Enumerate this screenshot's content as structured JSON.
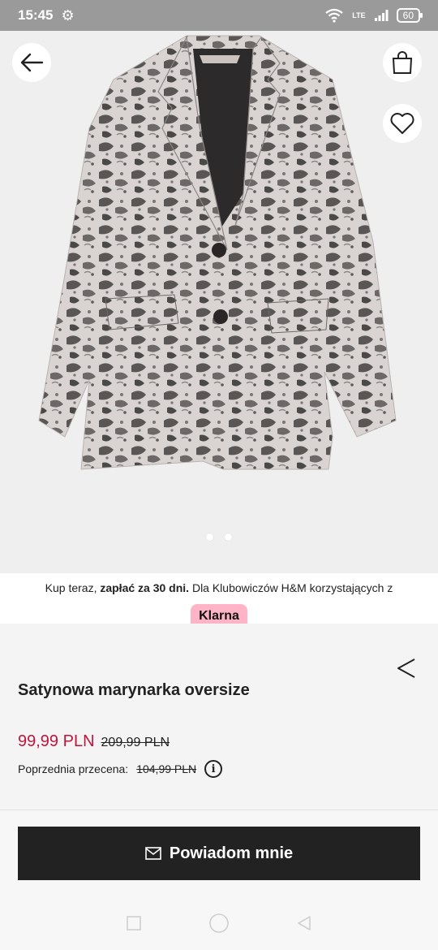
{
  "status_bar": {
    "time": "15:45",
    "network": "LTE",
    "battery": "60"
  },
  "hero": {
    "icons": {
      "back": "arrow-left-icon",
      "bag": "shopping-bag-icon",
      "favorite": "heart-icon"
    },
    "carousel_dots": 2
  },
  "promo": {
    "prefix": "Kup teraz, ",
    "bold": "zapłać za 30 dni.",
    "suffix": " Dla Klubowiczów H&M korzystających z",
    "klarna_label": "Klarna"
  },
  "product": {
    "title": "Satynowa marynarka oversize",
    "price_current": "99,99 PLN",
    "price_original": "209,99 PLN",
    "previous_label": "Poprzednia przecena:",
    "previous_price": "104,99 PLN",
    "info_icon_glyph": "i"
  },
  "footer": {
    "notify_label": "Powiadom mnie"
  },
  "colors": {
    "sale_red": "#c0143c",
    "button_dark": "#222222",
    "klarna_pink": "#ffb3c7"
  }
}
